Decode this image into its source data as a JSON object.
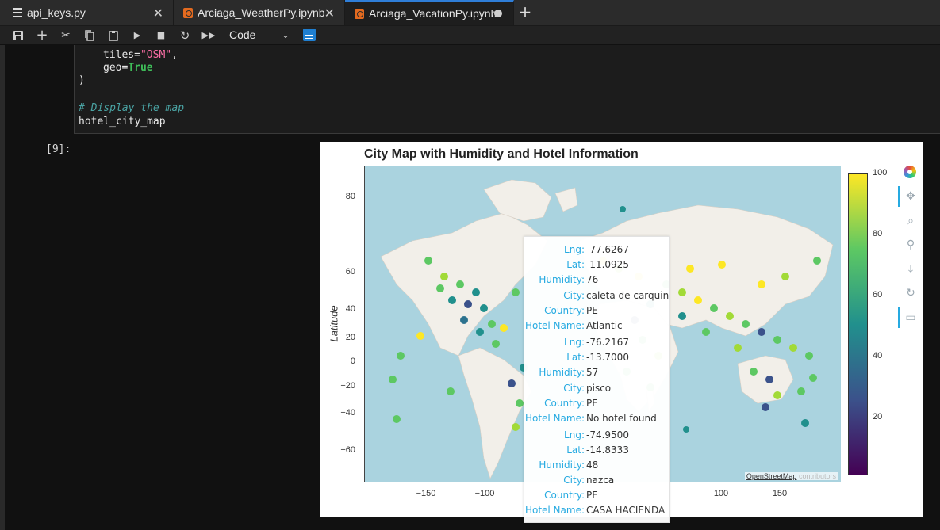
{
  "tabs": [
    {
      "label": "api_keys.py",
      "icon": "file-icon"
    },
    {
      "label": "Arciaga_WeatherPy.ipynb",
      "icon": "notebook-icon"
    },
    {
      "label": "Arciaga_VacationPy.ipynb",
      "icon": "notebook-icon",
      "active": true
    }
  ],
  "toolbar": {
    "cell_type": "Code"
  },
  "code": {
    "line1_key": "tiles",
    "line1_value": "\"OSM\"",
    "line2_key": "geo",
    "line2_value": "True",
    "line3": ")",
    "comment": "# Display the map",
    "line5": "hotel_city_map"
  },
  "prompt": "[9]:",
  "plot": {
    "title": "City Map with Humidity and Hotel Information",
    "ylabel": "Latitude",
    "attribution_link": "OpenStreetMap",
    "attribution_rest": "contributors",
    "yticks": [
      "80",
      "60",
      "40",
      "20",
      "0",
      "−20",
      "−40",
      "−60"
    ],
    "xticks": [
      "−150",
      "−100",
      "100",
      "150"
    ],
    "colorbar_ticks": [
      "100",
      "80",
      "60",
      "40",
      "20"
    ],
    "colormap": [
      "#440154",
      "#3b528b",
      "#21908d",
      "#5dc863",
      "#fde725"
    ],
    "land_color": "#f2efe9",
    "water_color": "#aad3df"
  },
  "tooltip": [
    {
      "lng": "-77.6267",
      "lat": "-11.0925",
      "humidity": "76",
      "city": "caleta de carquin",
      "country": "PE",
      "hotel": "Atlantic"
    },
    {
      "lng": "-76.2167",
      "lat": "-13.7000",
      "humidity": "57",
      "city": "pisco",
      "country": "PE",
      "hotel": "No hotel found"
    },
    {
      "lng": "-74.9500",
      "lat": "-14.8333",
      "humidity": "48",
      "city": "nazca",
      "country": "PE",
      "hotel": "CASA HACIENDA"
    }
  ],
  "tooltip_labels": {
    "lng": "Lng:",
    "lat": "Lat:",
    "humidity": "Humidity:",
    "city": "City:",
    "country": "Country:",
    "hotel": "Hotel Name:"
  }
}
